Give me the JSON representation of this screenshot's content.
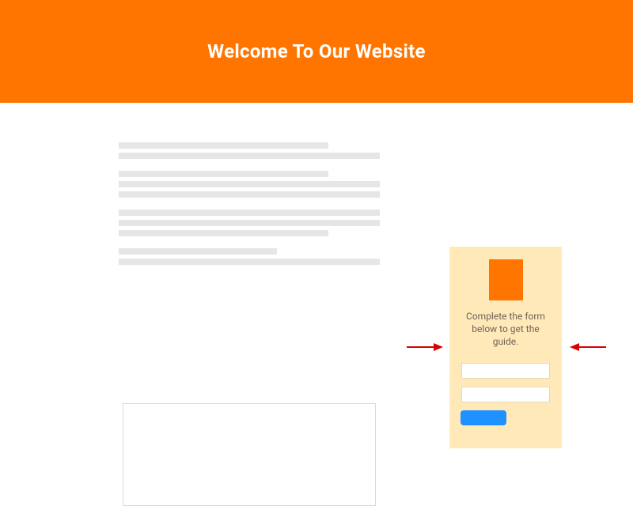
{
  "header": {
    "title": "Welcome To Our Website"
  },
  "form": {
    "prompt": "Complete the form below to get the guide.",
    "field1_placeholder": "",
    "field2_placeholder": "",
    "button_label": ""
  },
  "colors": {
    "brand": "#ff7500",
    "form_bg": "#ffe9b8",
    "button": "#1e90ff",
    "arrow": "#d80000",
    "placeholder_line": "#e6e6e6"
  }
}
